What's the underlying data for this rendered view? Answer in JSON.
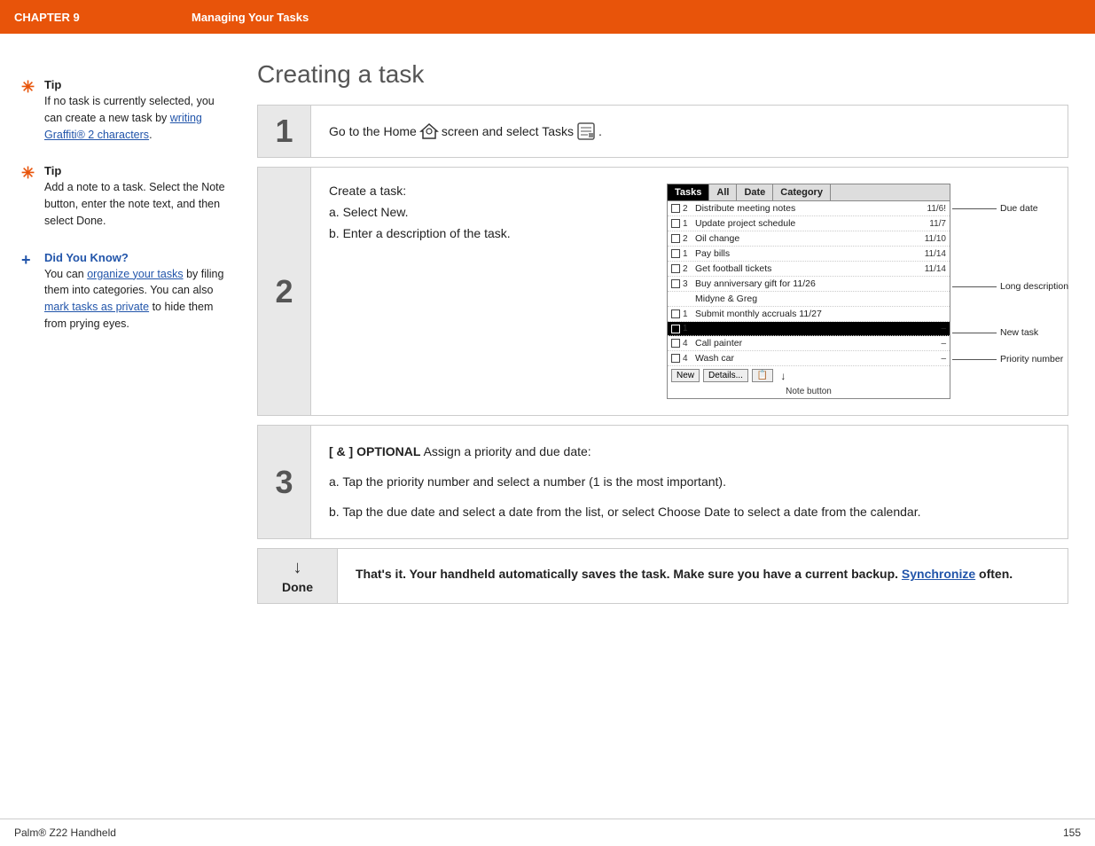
{
  "header": {
    "chapter_label": "CHAPTER 9",
    "title": "Managing Your Tasks"
  },
  "sidebar": {
    "tip1": {
      "icon": "✳",
      "title": "Tip",
      "text": "If no task is currently selected, you can create a new task by ",
      "link_text": "writing Graffiti® 2 characters",
      "text_after": "."
    },
    "tip2": {
      "icon": "✳",
      "title": "Tip",
      "text": "Add a note to a task. Select the Note button, enter the note text, and then select Done."
    },
    "did_you_know": {
      "icon": "+",
      "title": "Did You Know?",
      "text1": "You can ",
      "link1": "organize your tasks",
      "text2": " by filing them into categories. You can also ",
      "link2": "mark tasks as private",
      "text3": " to hide them from prying eyes."
    }
  },
  "content": {
    "section_title": "Creating a task",
    "step1": {
      "number": "1",
      "text_before": "Go to the Home",
      "text_after": "screen and select Tasks"
    },
    "step2": {
      "number": "2",
      "instruction": "Create a task:",
      "sub_a": "a.  Select New.",
      "sub_b": "b.  Enter a description of the task.",
      "mockup": {
        "tabs": [
          "Tasks",
          "All",
          "Date",
          "Category"
        ],
        "active_tab": "Tasks",
        "rows": [
          {
            "priority": "2",
            "desc": "Distribute meeting notes",
            "date": "11/6!"
          },
          {
            "priority": "1",
            "desc": "Update project schedule",
            "date": "11/7"
          },
          {
            "priority": "2",
            "desc": "Oil change",
            "date": "11/10"
          },
          {
            "priority": "1",
            "desc": "Pay bills",
            "date": "11/14"
          },
          {
            "priority": "2",
            "desc": "Get football tickets",
            "date": "11/14"
          },
          {
            "priority": "3",
            "desc": "Buy anniversary gift for",
            "date": "11/26"
          },
          {
            "priority": "",
            "desc": "Midyne & Greg",
            "date": ""
          },
          {
            "priority": "1",
            "desc": "Submit monthly accruals",
            "date": "11/27"
          },
          {
            "priority": "1",
            "desc": "",
            "date": "–",
            "highlighted": true
          },
          {
            "priority": "4",
            "desc": "Call painter",
            "date": "–"
          },
          {
            "priority": "4",
            "desc": "Wash car",
            "date": "–"
          }
        ],
        "buttons": [
          "New",
          "Details...",
          "📋"
        ],
        "annotations": {
          "due_date": "Due date",
          "long_desc": "Long description",
          "new_task": "New task",
          "priority": "Priority number",
          "note_btn": "Note button"
        }
      }
    },
    "step3": {
      "number": "3",
      "optional_prefix": "[ & ]",
      "optional_label": "OPTIONAL",
      "optional_text": " Assign a priority and due date:",
      "sub_a": "a.  Tap the priority number and select a number (1 is the most important).",
      "sub_b": "b.  Tap the due date and select a date from the list, or select Choose Date to select a date from the calendar."
    },
    "done": {
      "arrow": "↓",
      "label": "Done",
      "text1": "That's it. Your handheld automatically saves the task. Make sure you have a current backup. ",
      "link": "Synchronize",
      "text2": " often."
    }
  },
  "footer": {
    "brand": "Palm® Z22 Handheld",
    "page": "155"
  }
}
